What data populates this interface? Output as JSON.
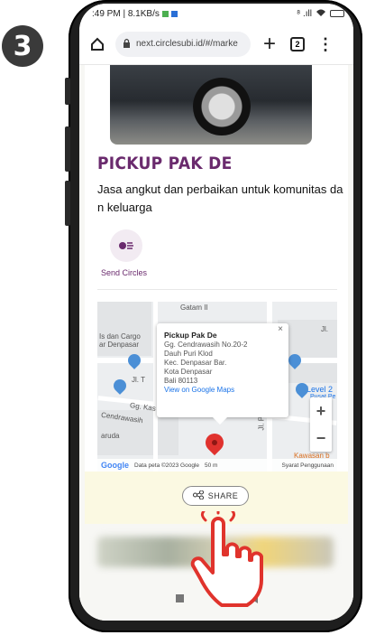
{
  "step": {
    "number": "3"
  },
  "status_bar": {
    "left_text": ":49 PM | 8.1KB/s",
    "right_text": "⁸ .ıll"
  },
  "browser": {
    "url": "next.circlesubi.id/#/marke",
    "tab_count": "2",
    "new_tab_label": "+",
    "menu_label": "⋮"
  },
  "listing": {
    "title": "PICKUP PAK DE",
    "description": "Jasa angkut dan perbaikan untuk komunitas dan keluarga",
    "send_label": "Send Circles"
  },
  "map": {
    "labels": {
      "street_top": "Gatam II",
      "left_area": "Is dan Cargo\nar Denpasar",
      "jl": "Jl. T",
      "gg_kas": "Gg. Kas",
      "cendrawasih": "Cendrawasih",
      "aruda": "aruda",
      "jl_right": "Jl.",
      "jl_pulau": "Jl. Pulau",
      "level2": "Level 2",
      "level2_sub": "Pusat Pe",
      "kawasan": "Kawasan b"
    },
    "popup": {
      "name": "Pickup Pak De",
      "address_lines": [
        "Gg. Cendrawasih No.20-2",
        "Dauh Puri Klod",
        "Kec. Denpasar Bar.",
        "Kota Denpasar",
        "Bali 80113"
      ],
      "link": "View on Google Maps",
      "close": "×"
    },
    "zoom_in": "+",
    "zoom_out": "−",
    "footer": {
      "logo": "Google",
      "data": "Data peta ©2023 Google",
      "scale": "50 m",
      "terms": "Syarat Penggunaan"
    }
  },
  "share": {
    "label": "SHARE"
  }
}
